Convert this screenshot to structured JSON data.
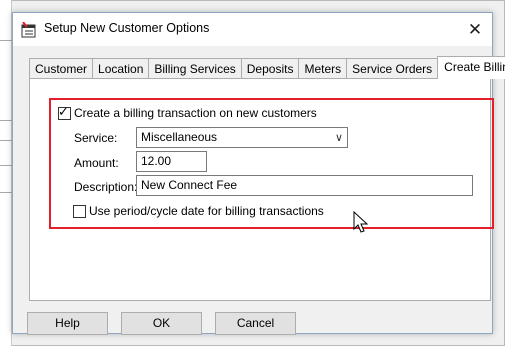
{
  "dialog": {
    "title": "Setup New Customer Options",
    "icon": "calendar-app-icon",
    "close_symbol": "✕"
  },
  "tabs": [
    {
      "label": "Customer",
      "active": false
    },
    {
      "label": "Location",
      "active": false
    },
    {
      "label": "Billing Services",
      "active": false
    },
    {
      "label": "Deposits",
      "active": false
    },
    {
      "label": "Meters",
      "active": false
    },
    {
      "label": "Service Orders",
      "active": false
    },
    {
      "label": "Create Billing",
      "active": true
    }
  ],
  "form": {
    "create_billing": {
      "label": "Create a billing transaction on new customers",
      "checked": true
    },
    "service": {
      "label": "Service:",
      "value": "Miscellaneous"
    },
    "amount": {
      "label": "Amount:",
      "value": "12.00"
    },
    "description": {
      "label": "Description:",
      "value": "New Connect Fee"
    },
    "use_period": {
      "label": "Use period/cycle date for billing transactions",
      "checked": false
    }
  },
  "buttons": {
    "help": "Help",
    "ok": "OK",
    "cancel": "Cancel"
  },
  "colors": {
    "highlight": "#e3202a",
    "title_bar": "#ffffff",
    "dialog_bg": "#f0f0f0"
  }
}
